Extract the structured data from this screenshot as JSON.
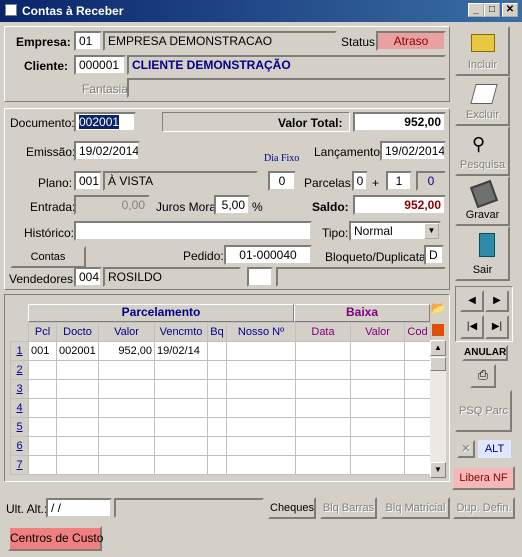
{
  "window": {
    "title": "Contas à Receber",
    "min": "_",
    "max": "□",
    "close": "✕"
  },
  "header": {
    "empresa_label": "Empresa:",
    "empresa_code": "01",
    "empresa_name": "EMPRESA DEMONSTRACAO",
    "status_label": "Status:",
    "status_value": "Atraso",
    "cliente_label": "Cliente:",
    "cliente_code": "000001",
    "cliente_name": "CLIENTE DEMONSTRAÇÃO",
    "fantasia_label": "Fantasia:"
  },
  "doc": {
    "documento_label": "Documento:",
    "documento_value": "002001",
    "valor_total_label": "Valor Total:",
    "valor_total_value": "952,00",
    "emissao_label": "Emissão:",
    "emissao_value": "19/02/2014",
    "dia_fixo_label": "Dia Fixo",
    "dia_fixo_value": "0",
    "lancamento_label": "Lançamento:",
    "lancamento_value": "19/02/2014",
    "plano_label": "Plano:",
    "plano_code": "001",
    "plano_name": "À VISTA",
    "parcelas_label": "Parcelas:",
    "parcelas_a": "0",
    "parcelas_plus": "+",
    "parcelas_b": "1",
    "parcelas_c": "0",
    "entrada_label": "Entrada:",
    "entrada_value": "0,00",
    "juros_label": "Juros Mora:",
    "juros_value": "5,00",
    "juros_unit": "%",
    "saldo_label": "Saldo:",
    "saldo_value": "952,00",
    "historico_label": "Histórico:",
    "historico_value": "",
    "tipo_label": "Tipo:",
    "tipo_value": "Normal",
    "contas_button": "Contas",
    "pedido_label": "Pedido:",
    "pedido_value": "01-000040",
    "bloqueto_label": "Bloqueto/Duplicata:",
    "bloqueto_value": "D",
    "vendedores_label": "Vendedores:",
    "vendedor_code": "004",
    "vendedor_name": "ROSILDO"
  },
  "grid": {
    "group_parcelamento": "Parcelamento",
    "group_baixa": "Baixa",
    "columns": [
      "Pcl",
      "Docto",
      "Valor",
      "Vencmto",
      "Bq",
      "Nosso Nº",
      "Data",
      "Valor",
      "Cod"
    ],
    "row_numbers": [
      "1",
      "2",
      "3",
      "4",
      "5",
      "6",
      "7"
    ],
    "rows": [
      [
        "001",
        "002001",
        "952,00",
        "19/02/14",
        "",
        "",
        "",
        "",
        ""
      ]
    ]
  },
  "sidebar": {
    "incluir": "Incluir",
    "excluir": "Excluir",
    "pesquisa": "Pesquisa",
    "gravar": "Gravar",
    "sair": "Sair",
    "anular": "ANULAR",
    "psq_parc": "PSQ Parc",
    "alt": "ALT",
    "libera_nf": "Libera NF"
  },
  "footer": {
    "ult_alt_label": "Ult. Alt.:",
    "ult_alt_value": " / /",
    "cheques": "Cheques",
    "blq_barras": "Blq Barras",
    "blq_matricial": "Blq Matricial",
    "dup_defin": "Dup. Defin.",
    "centros_custo": "Centros de Custo"
  },
  "colors": {
    "title_start": "#0a246a",
    "status_bg": "#e8a0a0",
    "libera_bg": "#f4b8b8",
    "centros_bg": "#f08080",
    "accent_blue": "#00008b",
    "saldo_red": "#8b0000"
  }
}
